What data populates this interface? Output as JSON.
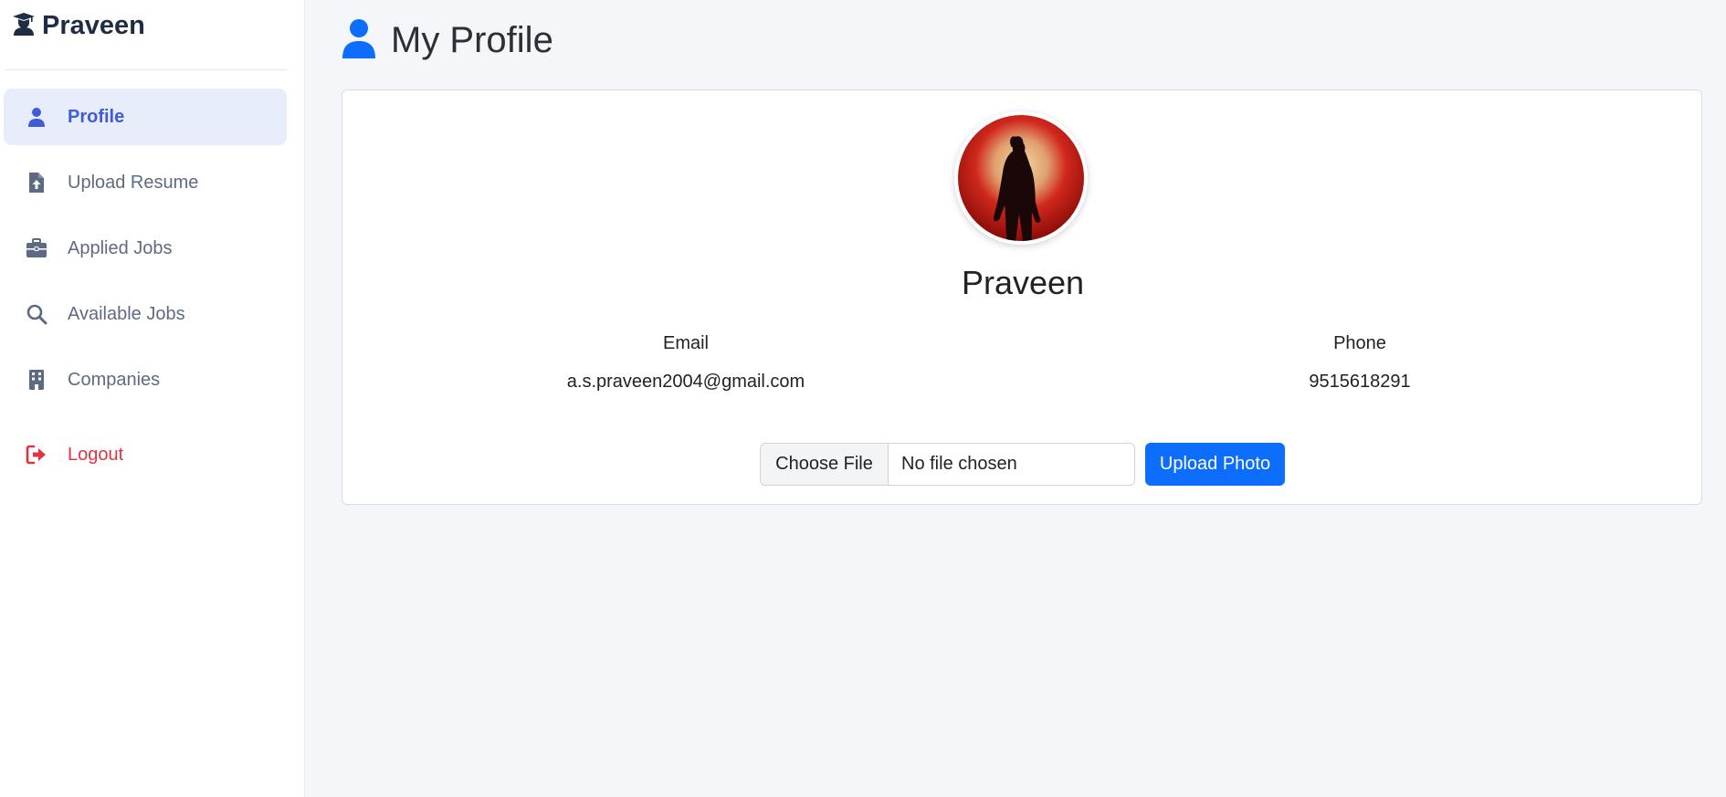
{
  "brand": {
    "name": "Praveen",
    "icon": "graduation-user-icon"
  },
  "sidebar": {
    "items": [
      {
        "label": "Profile",
        "icon": "user-icon",
        "active": true
      },
      {
        "label": "Upload Resume",
        "icon": "file-upload-icon",
        "active": false
      },
      {
        "label": "Applied Jobs",
        "icon": "briefcase-icon",
        "active": false
      },
      {
        "label": "Available Jobs",
        "icon": "search-icon",
        "active": false
      },
      {
        "label": "Companies",
        "icon": "building-icon",
        "active": false
      }
    ],
    "logout": {
      "label": "Logout",
      "icon": "sign-out-icon"
    }
  },
  "page": {
    "title": "My Profile",
    "title_icon": "user-icon"
  },
  "profile": {
    "name": "Praveen",
    "email_label": "Email",
    "email": "a.s.praveen2004@gmail.com",
    "phone_label": "Phone",
    "phone": "9515618291"
  },
  "upload": {
    "choose_label": "Choose File",
    "file_status": "No file chosen",
    "button_label": "Upload Photo"
  },
  "colors": {
    "accent": "#0d6efd",
    "active_nav": "#3f5bd8",
    "active_nav_bg": "#e8edfb",
    "logout": "#e03444",
    "brand": "#1f2d44"
  }
}
